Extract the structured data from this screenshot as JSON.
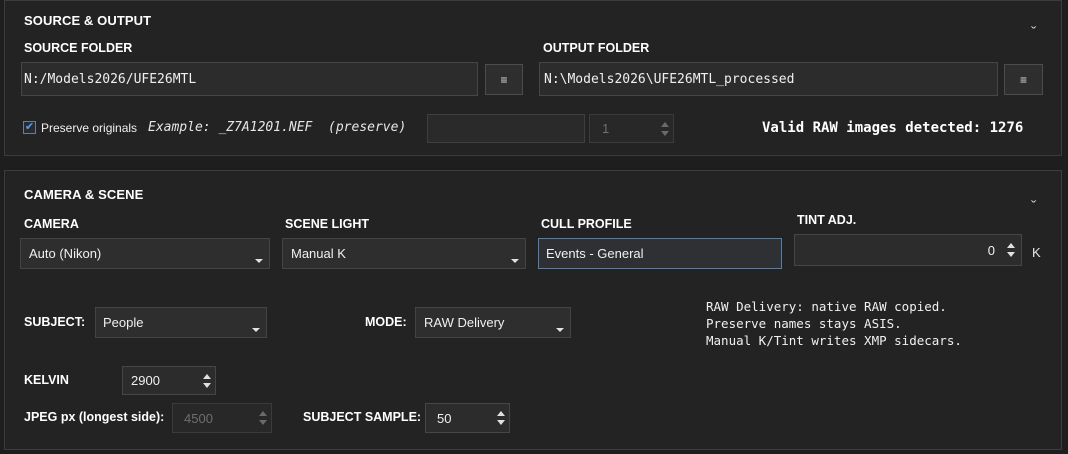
{
  "source_output": {
    "title": "SOURCE & OUTPUT",
    "collapse_glyph": "ˬ",
    "source_label": "SOURCE FOLDER",
    "source_value": "N:/Models2026/UFE26MTL",
    "output_label": "OUTPUT FOLDER",
    "output_value": "N:\\Models2026\\UFE26MTL_processed",
    "browse_glyph": "≡",
    "preserve_checked": true,
    "check_glyph": "✔",
    "preserve_label": "Preserve originals",
    "example_text": "Example: _Z7A1201.NEF  (preserve)",
    "prefix_value": "",
    "counter_value": "1",
    "detected_text": "Valid RAW images detected: 1276"
  },
  "camera_scene": {
    "title": "CAMERA & SCENE",
    "collapse_glyph": "ˬ",
    "camera_label": "CAMERA",
    "camera_value": "Auto (Nikon)",
    "scene_light_label": "SCENE LIGHT",
    "scene_light_value": "Manual K",
    "cull_profile_label": "CULL PROFILE",
    "cull_profile_value": "Events - General",
    "tint_label": "TINT ADJ.",
    "tint_value": "0",
    "tint_unit": "K",
    "subject_label": "SUBJECT:",
    "subject_value": "People",
    "mode_label": "MODE:",
    "mode_value": "RAW Delivery",
    "info_lines": [
      "RAW Delivery: native RAW copied.",
      "Preserve names stays ASIS.",
      "Manual K/Tint writes XMP sidecars."
    ],
    "kelvin_label": "KELVIN",
    "kelvin_value": "2900",
    "jpeg_label": "JPEG px (longest side):",
    "jpeg_value": "4500",
    "subject_sample_label": "SUBJECT SAMPLE:",
    "subject_sample_value": "50"
  },
  "colors": {
    "background": "#1e1e1e",
    "panel": "#232323",
    "focus_border": "#4d7fb0",
    "checkbox_check": "#4ea0ff"
  }
}
